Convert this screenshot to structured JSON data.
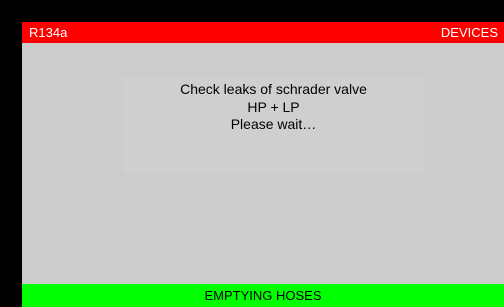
{
  "header": {
    "left_label": "R134a",
    "right_label": "DEVICES"
  },
  "message": {
    "line1": "Check leaks of schrader valve",
    "line2": "HP + LP",
    "line3": "Please wait…"
  },
  "status_bar": {
    "label": "EMPTYING HOSES"
  },
  "colors": {
    "frame": "#000000",
    "screen_background": "#cccccc",
    "header_background": "#ff0000",
    "header_text": "#ffffff",
    "status_background": "#00ff00",
    "status_text": "#000000"
  }
}
